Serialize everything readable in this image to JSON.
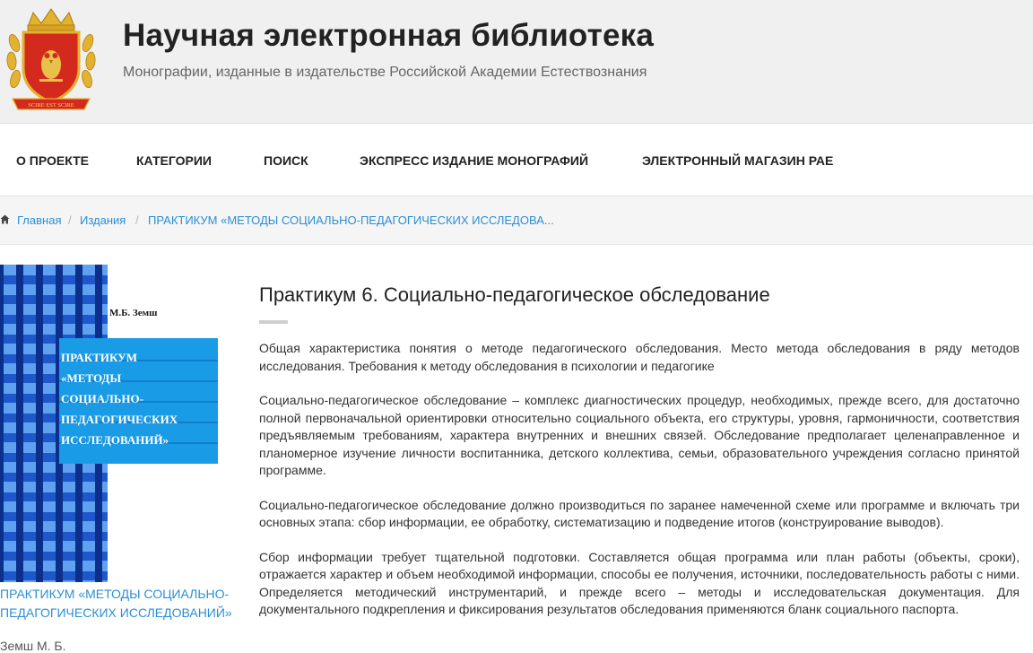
{
  "header": {
    "title": "Научная электронная библиотека",
    "subtitle": "Монографии, изданные в издательстве Российской Академии Естествознания",
    "logo_text": "SCIRE EST SCIRE"
  },
  "nav": [
    {
      "label": "О ПРОЕКТЕ"
    },
    {
      "label": "КАТЕГОРИИ"
    },
    {
      "label": "ПОИСК"
    },
    {
      "label": "ЭКСПРЕСС ИЗДАНИЕ МОНОГРАФИЙ"
    },
    {
      "label": "ЭЛЕКТРОННЫЙ МАГАЗИН РАЕ"
    }
  ],
  "breadcrumb": {
    "icon": "home-icon",
    "items": [
      "Главная",
      "Издания",
      "ПРАКТИКУМ «МЕТОДЫ СОЦИАЛЬНО-ПЕДАГОГИЧЕСКИХ ИССЛЕДОВА..."
    ],
    "separator": "/"
  },
  "book": {
    "cover_author": "М.Б. Земш",
    "cover_title_lines": [
      "ПРАКТИКУМ",
      "«МЕТОДЫ",
      "СОЦИАЛЬНО-",
      "ПЕДАГОГИЧЕСКИХ",
      "ИССЛЕДОВАНИЙ»"
    ],
    "caption": "ПРАКТИКУМ «МЕТОДЫ СОЦИАЛЬНО-ПЕДАГОГИЧЕСКИХ ИССЛЕДОВАНИЙ»",
    "author": "Земш М. Б."
  },
  "article": {
    "title": "Практикум 6. Социально-педагогическое обследование",
    "paragraphs": [
      "Общая характеристика понятия о методе педагогического обследования. Место метода обследования в ряду методов исследования. Требования к методу обследования в психологии и педагогике",
      "Социально-педагогическое обследование – комплекс диагностических процедур, необходимых, прежде всего, для достаточно полной первоначальной ориентировки относительно социального объекта, его структуры, уровня, гармоничности, соответствия предъявляемым требованиям, характера внутренних и внешних связей. Обследование предполагает целенаправленное и планомерное изучение личности воспитанника, детского коллектива, семьи, образовательного учреждения согласно принятой программе.",
      "Социально-педагогическое обследование должно производиться по заранее намеченной схеме или программе и включать три основных этапа: сбор информации, ее обработку, систематизацию и подведение итогов (конструирование выводов).",
      "Сбор информации требует тщательной подготовки. Составляется общая программа или план работы (объекты, сроки), отражается характер и объем необходимой информации, способы ее получения, источники, последовательность работы с ними. Определяется методический инструментарий, и прежде всего – методы и исследовательская документация. Для документального подкрепления и фиксирования результатов обследования применяются бланк социального паспорта."
    ]
  },
  "colors": {
    "header_bg": "#f0f0f0",
    "link": "#2a8fd5",
    "cover_blue": "#1d57c9",
    "cover_band": "#1a9be6",
    "logo_red": "#d42a1e",
    "logo_gold": "#e3b230"
  }
}
